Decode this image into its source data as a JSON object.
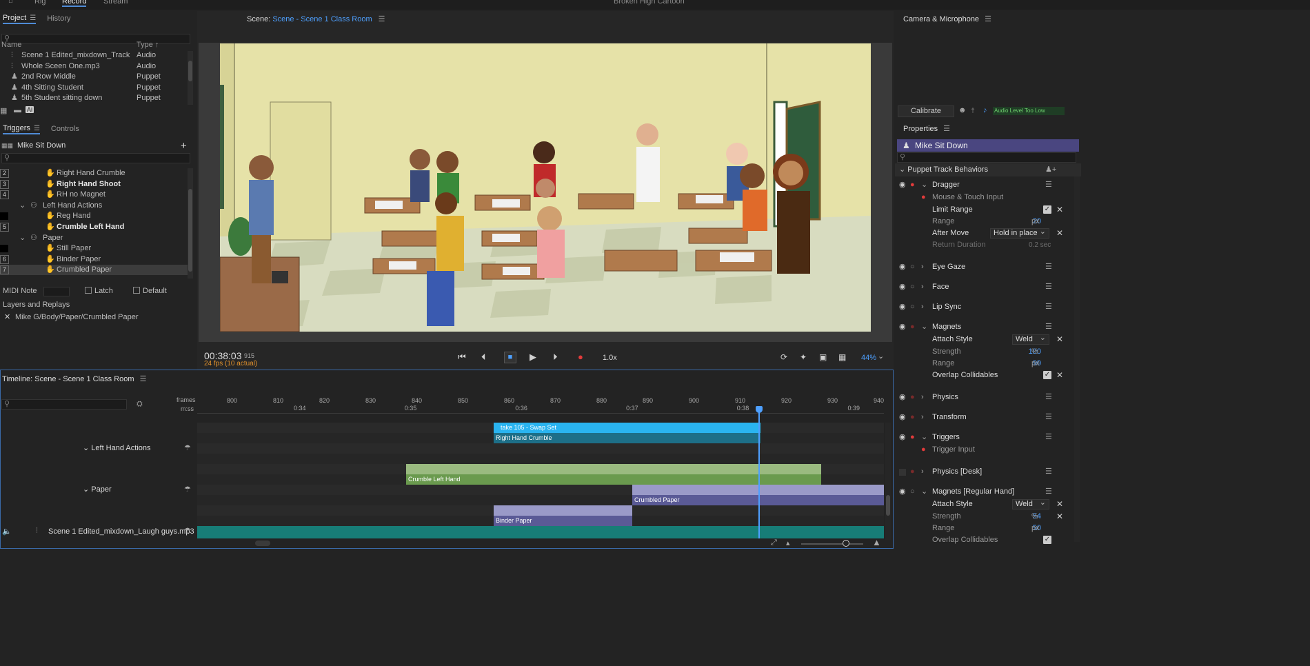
{
  "menubar": {
    "items": [
      "Rig",
      "Record",
      "Stream"
    ],
    "active": "Record",
    "title": "Broken High Cartoon"
  },
  "project": {
    "tabs": [
      "Project",
      "History"
    ],
    "col_name": "Name",
    "col_type": "Type",
    "items": [
      {
        "name": "Scene 1 Edited_mixdown_Track Girls...",
        "type": "Audio",
        "icon": "audio-icon"
      },
      {
        "name": "Whole Sceen One.mp3",
        "type": "Audio",
        "icon": "audio-icon"
      },
      {
        "name": "2nd Row Middle",
        "type": "Puppet",
        "icon": "puppet-icon"
      },
      {
        "name": "4th Sitting Student",
        "type": "Puppet",
        "icon": "puppet-icon"
      },
      {
        "name": "5th Student sitting down",
        "type": "Puppet",
        "icon": "puppet-icon"
      }
    ],
    "ai_badge": "Ai"
  },
  "triggers": {
    "tabs": [
      "Triggers",
      "Controls"
    ],
    "puppet": "Mike Sit Down",
    "add": "+",
    "rows": [
      {
        "num": "2",
        "label": "Right Hand Crumble",
        "level": 2,
        "bold": false
      },
      {
        "num": "3",
        "label": "Right Hand Shoot",
        "level": 2,
        "bold": true
      },
      {
        "num": "4",
        "label": "RH no Magnet",
        "level": 2,
        "bold": false
      },
      {
        "num": "",
        "label": "Left Hand Actions",
        "level": 1,
        "bold": false,
        "group": true
      },
      {
        "num": "",
        "label": "Reg Hand",
        "level": 2,
        "bold": false
      },
      {
        "num": "5",
        "label": "Crumble Left Hand",
        "level": 2,
        "bold": true
      },
      {
        "num": "",
        "label": "Paper",
        "level": 1,
        "bold": false,
        "group": true
      },
      {
        "num": "",
        "label": "Still Paper",
        "level": 2,
        "bold": false
      },
      {
        "num": "6",
        "label": "Binder Paper",
        "level": 2,
        "bold": false
      },
      {
        "num": "7",
        "label": "Crumbled Paper",
        "level": 2,
        "bold": false,
        "selected": true
      }
    ],
    "midi_label": "MIDI Note",
    "latch": "Latch",
    "default": "Default",
    "layers_title": "Layers and Replays",
    "layer_path": "Mike G/Body/Paper/Crumbled Paper"
  },
  "scene": {
    "label": "Scene:",
    "name": "Scene - Scene 1 Class Room",
    "time": "00:38:03",
    "frame": "915",
    "fps": "24 fps (10 actual)",
    "speed": "1.0x",
    "zoom": "44%"
  },
  "camera": {
    "title": "Camera & Microphone",
    "calibrate": "Calibrate",
    "audio_level": "Audio Level Too Low"
  },
  "properties": {
    "title": "Properties",
    "puppet": "Mike Sit Down",
    "section": "Puppet Track Behaviors",
    "dragger": "Dragger",
    "mouse_touch": "Mouse & Touch Input",
    "limit_range": "Limit Range",
    "range_label": "Range",
    "dragger_range": "20",
    "px": "px",
    "after_move": "After Move",
    "after_move_val": "Hold in place",
    "return_duration": "Return Duration",
    "return_val": "0.2 sec",
    "eye_gaze": "Eye Gaze",
    "face": "Face",
    "lip_sync": "Lip Sync",
    "magnets": "Magnets",
    "attach_style": "Attach Style",
    "weld": "Weld",
    "strength": "Strength",
    "strength_val": "100",
    "pct": "%",
    "magnets_range": "99",
    "overlap": "Overlap Collidables",
    "physics": "Physics",
    "transform": "Transform",
    "triggers": "Triggers",
    "trigger_input": "Trigger Input",
    "physics_desk": "Physics [Desk]",
    "magnets_regular": "Magnets [Regular Hand]",
    "strength2": "54",
    "range2": "50"
  },
  "timeline": {
    "title": "Timeline: Scene - Scene 1 Class Room",
    "frames_label": "frames",
    "mss_label": "m:ss",
    "frame_ticks": [
      "800",
      "810",
      "820",
      "830",
      "840",
      "850",
      "860",
      "870",
      "880",
      "890",
      "900",
      "910",
      "920",
      "930",
      "940"
    ],
    "time_ticks": [
      "0:34",
      "0:35",
      "0:36",
      "0:37",
      "0:38",
      "0:39"
    ],
    "tracks": [
      "Left Hand Actions",
      "Paper",
      "Scene 1 Edited_mixdown_Laugh guys.mp3"
    ],
    "clips": {
      "take": "take 105 - Swap Set",
      "rhc": "Right Hand Crumble",
      "clh": "Crumble Left Hand",
      "crumbled": "Crumbled Paper",
      "binder": "Binder Paper"
    }
  },
  "colors": {
    "accent": "#4ea0ff",
    "record": "#e23b3b",
    "clip_blue": "#2ab4f0",
    "clip_teal": "#1d6f88",
    "clip_green": "#7aa85a",
    "clip_purple": "#6b6ba8",
    "audio_teal": "#177d77",
    "puppet_purple": "#4a4680"
  }
}
